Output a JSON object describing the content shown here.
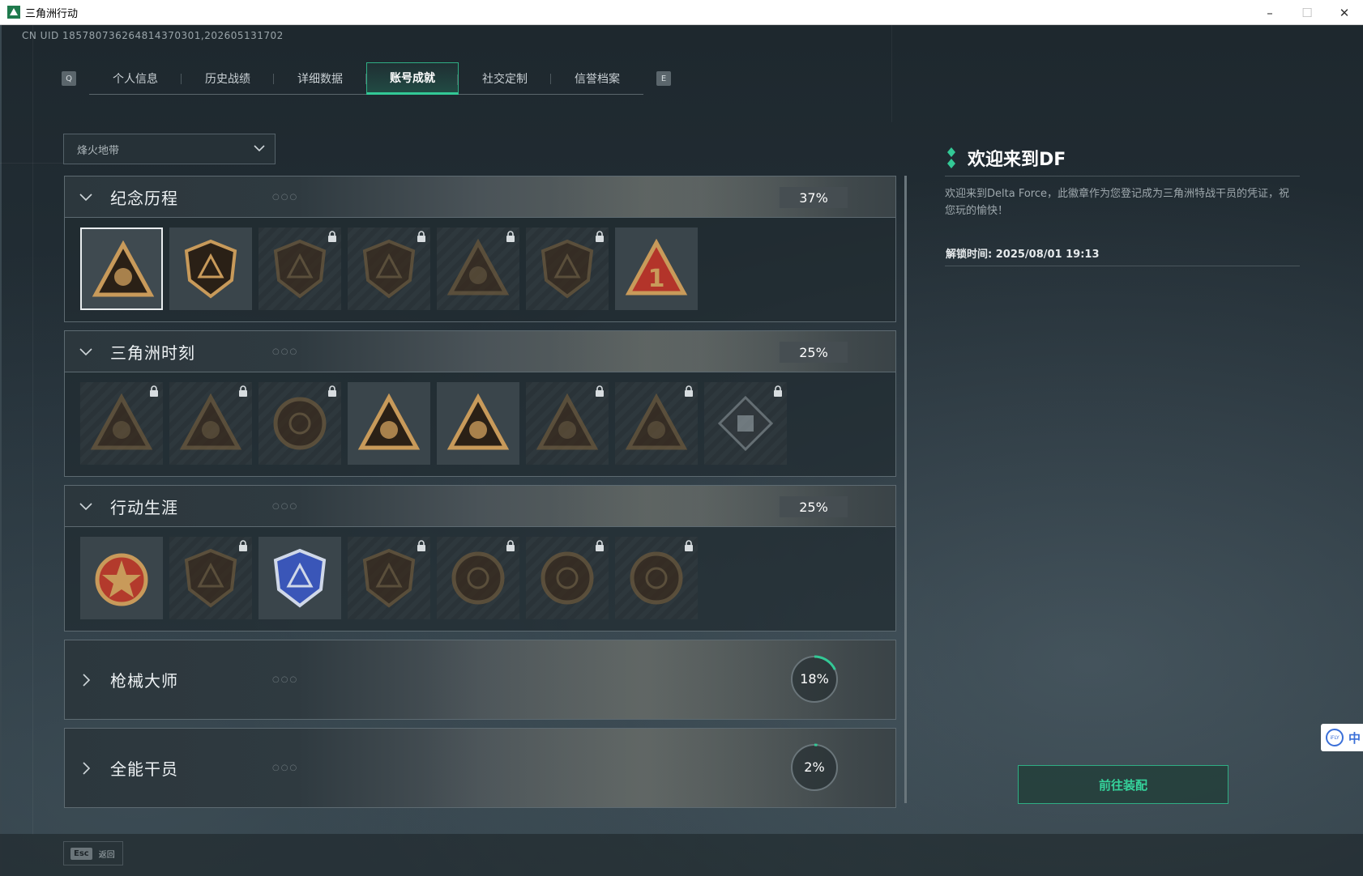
{
  "window": {
    "title": "三角洲行动",
    "minimize": "–",
    "maximize": "☐",
    "close": "✕"
  },
  "uid": "CN UID 185780736264814370301,202605131702",
  "tabs": {
    "left_key": "Q",
    "right_key": "E",
    "items": [
      {
        "label": "个人信息"
      },
      {
        "label": "历史战绩"
      },
      {
        "label": "详细数据"
      },
      {
        "label": "账号成就",
        "active": true
      },
      {
        "label": "社交定制"
      },
      {
        "label": "信誉档案"
      }
    ]
  },
  "mode_select": {
    "value": "烽火地带"
  },
  "sections": [
    {
      "title": "纪念历程",
      "progress": "37%",
      "expanded": true,
      "dots": "○○○",
      "badges": [
        {
          "icon": "shield-triangle-emblem",
          "locked": false,
          "selected": true
        },
        {
          "icon": "helicopter-emblem",
          "locked": false
        },
        {
          "icon": "hex-shield-emblem",
          "locked": true
        },
        {
          "icon": "vehicle-emblem",
          "locked": true
        },
        {
          "icon": "soldier-triangle-emblem",
          "locked": true
        },
        {
          "icon": "crossed-swords-emblem",
          "locked": true
        },
        {
          "icon": "number-one-triangle-emblem",
          "locked": false
        }
      ]
    },
    {
      "title": "三角洲时刻",
      "progress": "25%",
      "expanded": true,
      "dots": "○○○",
      "badges": [
        {
          "icon": "box-triangle-emblem",
          "locked": true
        },
        {
          "icon": "mask-triangle-emblem",
          "locked": true
        },
        {
          "icon": "kneeling-soldier-emblem",
          "locked": true
        },
        {
          "icon": "hands-triangle-emblem",
          "locked": false
        },
        {
          "icon": "fist-triangle-emblem",
          "locked": false
        },
        {
          "icon": "squad-triangle-emblem",
          "locked": true
        },
        {
          "icon": "eagle-triangle-emblem",
          "locked": true
        },
        {
          "icon": "cube-diamond-emblem",
          "locked": true
        }
      ]
    },
    {
      "title": "行动生涯",
      "progress": "25%",
      "expanded": true,
      "dots": "○○○",
      "badges": [
        {
          "icon": "star-medal-emblem",
          "locked": false
        },
        {
          "icon": "chevron-shield-emblem",
          "locked": true
        },
        {
          "icon": "blue-police-shield-emblem",
          "locked": false
        },
        {
          "icon": "hexagon-shield-emblem",
          "locked": true
        },
        {
          "icon": "orb-emblem",
          "locked": true
        },
        {
          "icon": "skull-crosshair-emblem",
          "locked": true
        },
        {
          "icon": "eye-emblem",
          "locked": true
        }
      ]
    },
    {
      "title": "枪械大师",
      "progress": "18%",
      "progress_value": 0.18,
      "expanded": false,
      "dots": "○○○"
    },
    {
      "title": "全能干员",
      "progress": "2%",
      "progress_value": 0.02,
      "expanded": false,
      "dots": "○○○"
    }
  ],
  "detail": {
    "title": "欢迎来到DF",
    "description": "欢迎来到Delta Force，此徽章作为您登记成为三角洲特战干员的凭证，祝您玩的愉快！",
    "unlock_time": "解锁时间: 2025/08/01 19:13",
    "equip_button": "前往装配"
  },
  "footer": {
    "esc_key": "Esc",
    "esc_label": "返回"
  },
  "ime": {
    "logo": "iFLY",
    "char": "中"
  },
  "colors": {
    "accent": "#33c996",
    "gold": "#c89a5a",
    "locked_gold": "#6e5a3c",
    "blue_badge": "#3a56b8"
  }
}
